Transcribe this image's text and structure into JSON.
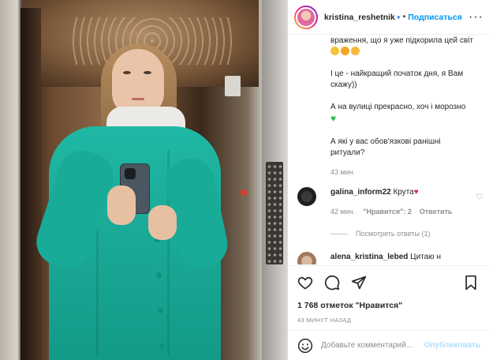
{
  "header": {
    "username": "kristina_reshetnik",
    "separator": "•",
    "follow_label": "Подписаться",
    "more_icon": "more-icon"
  },
  "caption": {
    "line1": "враження, що я уже підкорила цей світ",
    "paragraph2": "І це - найкращий початок дня, я Вам скажу))",
    "paragraph3": "А на вулиці прекрасно, хоч і морозно",
    "paragraph4": "А які у вас обов'язкові ранішні ритуали?",
    "time": "43 мин."
  },
  "comments": [
    {
      "username": "galina_inform22",
      "text": "Крута",
      "time": "42 мин.",
      "likes_label": "\"Нравится\": 2",
      "reply_label": "Ответить",
      "view_replies": "Посмотреть ответы (1)"
    },
    {
      "username": "alena_kristina_lebed",
      "text": "Цитаю н"
    }
  ],
  "actions": {
    "likes": "1 768 отметок \"Нравится\"",
    "posted": "43 МИНУТ НАЗАД"
  },
  "add_comment": {
    "placeholder": "Добавьте комментарий...",
    "publish_label": "Опубликовать"
  },
  "colors": {
    "accent": "#0095f6",
    "publish_disabled": "#b2dffc",
    "jacket": "#1fb8a4",
    "heart_green": "#2ebd4f",
    "heart_red": "#e0243c"
  }
}
